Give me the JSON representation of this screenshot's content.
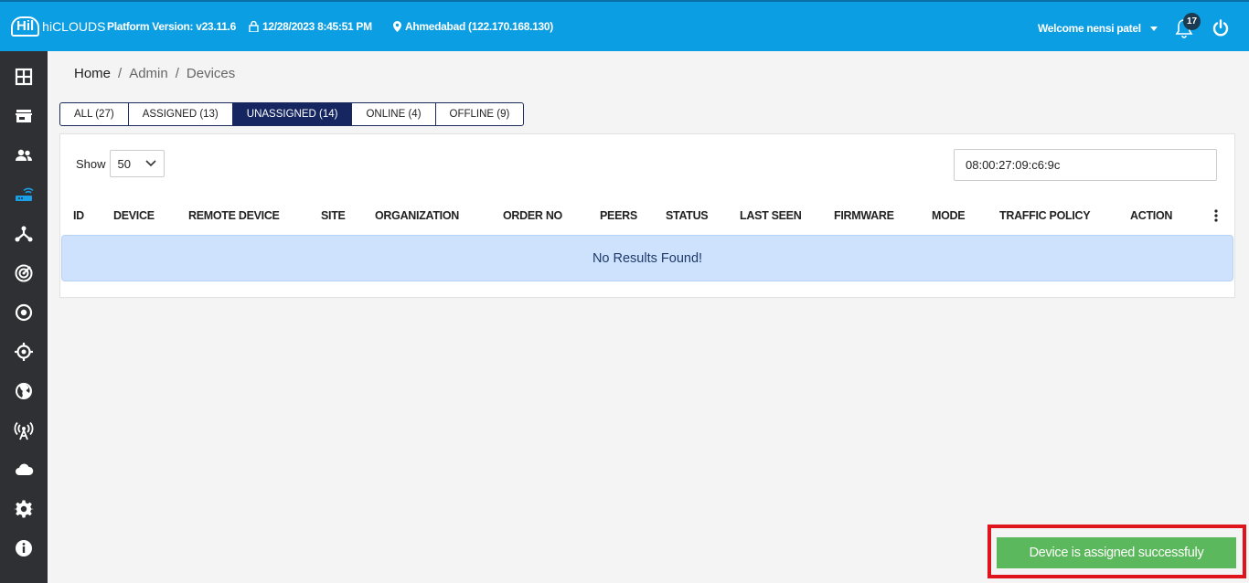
{
  "header": {
    "logo_mark": "Hil",
    "brand": "hiCLOUDS",
    "platform_version": "Platform Version: v23.11.6",
    "datetime": "12/28/2023 8:45:51 PM",
    "location": "Ahmedabad (122.170.168.130)",
    "welcome": "Welcome nensi patel",
    "notification_count": "17"
  },
  "sidebar": {
    "items": [
      {
        "icon": "dashboard-grid-icon"
      },
      {
        "icon": "store-icon"
      },
      {
        "icon": "users-icon"
      },
      {
        "icon": "router-icon",
        "active": true
      },
      {
        "icon": "network-icon"
      },
      {
        "icon": "radar-icon"
      },
      {
        "icon": "target-circle-icon"
      },
      {
        "icon": "crosshair-icon"
      },
      {
        "icon": "globe-icon"
      },
      {
        "icon": "antenna-icon"
      },
      {
        "icon": "cloud-icon"
      },
      {
        "icon": "gear-icon"
      },
      {
        "icon": "info-icon"
      }
    ],
    "active_color": "#1aa0e8"
  },
  "breadcrumb": {
    "home": "Home",
    "sep1": "/",
    "admin": "Admin",
    "sep2": "/",
    "devices": "Devices"
  },
  "tabs": [
    {
      "label": "ALL (27)"
    },
    {
      "label": "ASSIGNED (13)"
    },
    {
      "label": "UNASSIGNED (14)",
      "active": true
    },
    {
      "label": "ONLINE (4)"
    },
    {
      "label": "OFFLINE (9)"
    }
  ],
  "table": {
    "show_label": "Show",
    "page_size": "50",
    "search_value": "08:00:27:09:c6:9c",
    "columns": [
      "ID",
      "DEVICE",
      "REMOTE DEVICE",
      "SITE",
      "ORGANIZATION",
      "ORDER NO",
      "PEERS",
      "STATUS",
      "LAST SEEN",
      "FIRMWARE",
      "MODE",
      "TRAFFIC POLICY",
      "ACTION"
    ],
    "empty_message": "No Results Found!"
  },
  "toast": {
    "message": "Device is assigned successfuly"
  },
  "colors": {
    "topbar": "#0b9ee3",
    "sidebar": "#2e3033",
    "active_tab": "#152660",
    "toast": "#5cb85c",
    "highlight_frame": "#e0141d"
  }
}
